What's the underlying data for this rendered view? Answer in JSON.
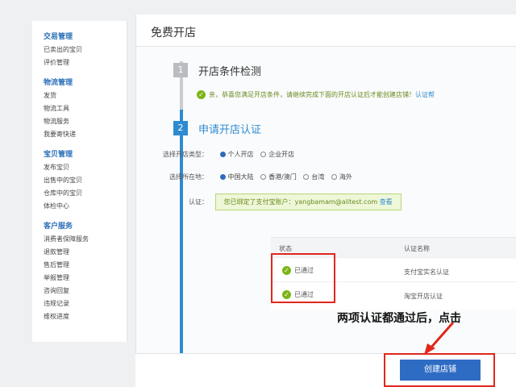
{
  "sidebar": {
    "groups": [
      {
        "title": "交易管理",
        "items": [
          "已卖出的宝贝",
          "评价管理"
        ]
      },
      {
        "title": "物流管理",
        "items": [
          "发货",
          "物流工具",
          "物流服务",
          "我要寄快递"
        ]
      },
      {
        "title": "宝贝管理",
        "items": [
          "发布宝贝",
          "出售中的宝贝",
          "仓库中的宝贝",
          "体检中心"
        ]
      },
      {
        "title": "客户服务",
        "items": [
          "消费者保障服务",
          "退款管理",
          "售后管理",
          "举报管理",
          "咨询回复",
          "违规记录",
          "维权进度"
        ]
      }
    ]
  },
  "main": {
    "title": "免费开店",
    "step1": {
      "number": "1",
      "title": "开店条件检测"
    },
    "notice": {
      "text": "亲，恭喜您满足开店条件，请继续完成下面的开店认证后才能创建店铺！",
      "highlight": "认证帮"
    },
    "step2": {
      "number": "2",
      "title": "申请开店认证"
    },
    "form": {
      "shop_type_label": "选择开店类型：",
      "shop_type_options": [
        "个人开店",
        "企业开店"
      ],
      "location_label": "选择所在地：",
      "location_options": [
        "中国大陆",
        "香港/澳门",
        "台湾",
        "海外"
      ],
      "auth_label": "认证：",
      "auth_text": "您已绑定了支付宝账户：yangbamam@alitest.com",
      "auth_link": "查看"
    },
    "table": {
      "headers": [
        "状态",
        "认证名称"
      ],
      "rows": [
        {
          "status": "已通过",
          "name": "支付宝实名认证"
        },
        {
          "status": "已通过",
          "name": "淘宝开店认证"
        }
      ]
    },
    "annotation": "两项认证都通过后，点击",
    "apply_button": "创建店铺"
  },
  "colors": {
    "accent": "#2e8bd0",
    "success": "#7cb518",
    "highlight_red": "#e0281c",
    "button": "#2e6cc4"
  }
}
